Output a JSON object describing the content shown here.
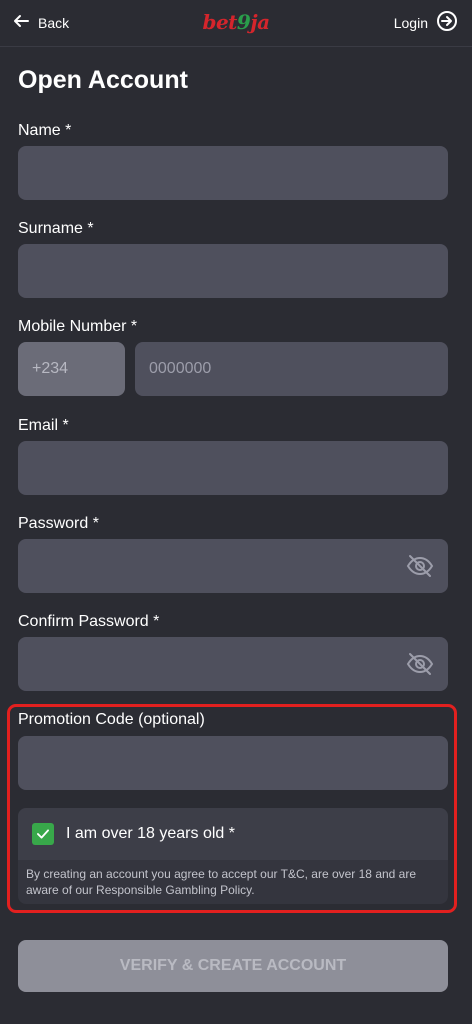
{
  "header": {
    "back_label": "Back",
    "logo_part_red_1": "bet",
    "logo_part_green": "9",
    "logo_part_red_2": "ja",
    "login_label": "Login"
  },
  "form": {
    "title": "Open Account",
    "name_label": "Name *",
    "surname_label": "Surname *",
    "mobile_label": "Mobile Number *",
    "mobile_prefix": "+234",
    "mobile_placeholder": "0000000",
    "email_label": "Email *",
    "password_label": "Password *",
    "confirm_password_label": "Confirm Password *",
    "promo_label": "Promotion Code (optional)",
    "age_checkbox_label": "I am over 18 years old *",
    "age_checked": true,
    "terms_text": "By creating an account you agree to accept our T&C, are over 18 and are aware of our Responsible Gambling Policy.",
    "submit_label": "VERIFY & CREATE ACCOUNT"
  },
  "colors": {
    "background": "#2b2c33",
    "field": "#4f505d",
    "highlight_border": "#e2201f",
    "check": "#38a84a",
    "logo_red": "#d4252c",
    "logo_green": "#2a9d4b"
  },
  "icons": [
    "arrow-left-icon",
    "login-arrow-icon",
    "eye-off-icon",
    "check-icon"
  ]
}
